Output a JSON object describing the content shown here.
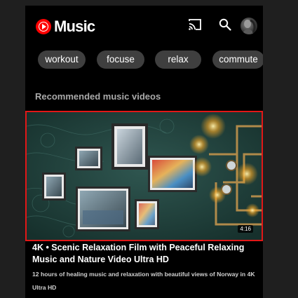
{
  "app": {
    "name": "Music",
    "icons": [
      "cast-icon",
      "search-icon",
      "avatar"
    ]
  },
  "chips": [
    "workout",
    "focuse",
    "relax",
    "commute"
  ],
  "section": {
    "title": "Recommended music videos"
  },
  "video": {
    "title": "4K • Scenic Relaxation Film with Peaceful Relaxing Music and Nature Video Ultra HD",
    "description": "12 hours of healing music and relaxation with beautiful views of Norway in 4K Ultra HD",
    "duration": "4:16"
  },
  "colors": {
    "background": "#000000",
    "brand": "#ff0000",
    "chip": "#3f3f3f",
    "highlight": "#e21717"
  }
}
